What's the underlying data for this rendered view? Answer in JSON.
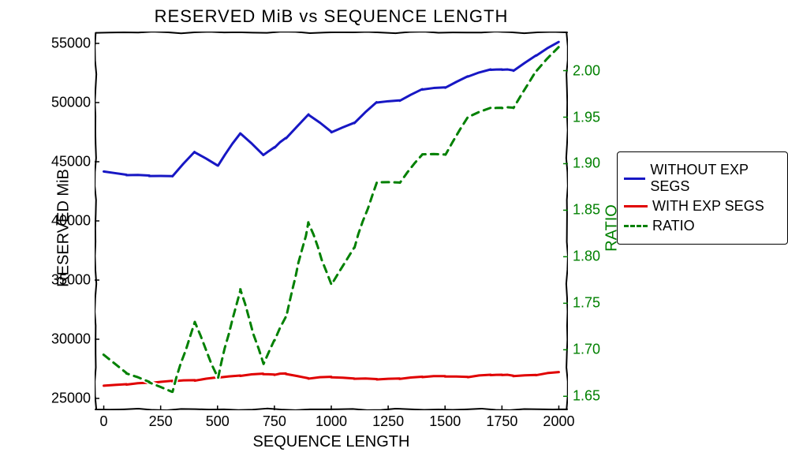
{
  "chart_data": {
    "type": "line",
    "title": "RESERVED MiB vs SEQUENCE LENGTH",
    "xlabel": "SEQUENCE LENGTH",
    "ylabel_left": "RESERVED MiB",
    "ylabel_right": "RATIO",
    "x": [
      0,
      100,
      200,
      300,
      400,
      500,
      600,
      700,
      750,
      800,
      900,
      1000,
      1100,
      1200,
      1300,
      1400,
      1500,
      1600,
      1700,
      1750,
      1800,
      1900,
      2000
    ],
    "x_ticks": [
      0,
      250,
      500,
      750,
      1000,
      1250,
      1500,
      1750,
      2000
    ],
    "y_left_ticks": [
      25000,
      30000,
      35000,
      40000,
      45000,
      50000,
      55000
    ],
    "y_right_ticks": [
      1.65,
      1.7,
      1.75,
      1.8,
      1.85,
      1.9,
      1.95,
      2.0
    ],
    "y_left_lim": [
      24000,
      56000
    ],
    "y_right_lim": [
      1.635,
      2.042
    ],
    "series_left": [
      {
        "name": "WITHOUT EXP SEGS",
        "color": "#1717c4",
        "dashed": false,
        "values": [
          44200,
          43900,
          43800,
          43800,
          45800,
          44700,
          47400,
          45600,
          46200,
          47000,
          49000,
          47500,
          48300,
          50000,
          50200,
          51100,
          51300,
          52200,
          52800,
          52800,
          52700,
          54000,
          55100
        ]
      },
      {
        "name": "WITH EXP SEGS",
        "color": "#e00000",
        "dashed": false,
        "values": [
          26100,
          26200,
          26300,
          26500,
          26500,
          26800,
          26900,
          27100,
          27000,
          27100,
          26700,
          26800,
          26700,
          26600,
          26700,
          26800,
          26900,
          26800,
          27000,
          27000,
          26900,
          27000,
          27200
        ]
      }
    ],
    "series_right": [
      {
        "name": "RATIO",
        "color": "#008000",
        "dashed": true,
        "values": [
          1.695,
          1.675,
          1.665,
          1.655,
          1.73,
          1.67,
          1.765,
          1.685,
          1.71,
          1.735,
          1.837,
          1.77,
          1.81,
          1.88,
          1.88,
          1.91,
          1.91,
          1.95,
          1.96,
          1.96,
          1.96,
          2.0,
          2.025
        ]
      }
    ],
    "legend": [
      {
        "label": "WITHOUT EXP SEGS",
        "color": "#1717c4",
        "dashed": false
      },
      {
        "label": "WITH EXP SEGS",
        "color": "#e00000",
        "dashed": false
      },
      {
        "label": "RATIO",
        "color": "#008000",
        "dashed": true
      }
    ]
  }
}
